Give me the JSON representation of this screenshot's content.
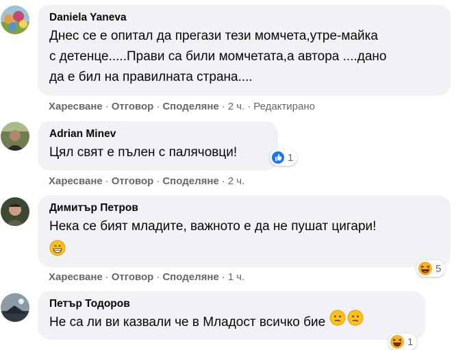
{
  "comments": [
    {
      "author": "Daniela Yaneva",
      "lines": [
        "Днес се е опитал да прегази тези момчета,утре-майка",
        "с детенце.....Прави са били момчетата,а автора ....дано",
        "да е бил на правилната страна...."
      ],
      "like": "Харесване",
      "reply": "Отговор",
      "share": "Споделяне",
      "time": "2 ч.",
      "edited": "Редактирано"
    },
    {
      "author": "Adrian Minev",
      "lines": [
        "Цял свят е пълен с палячовци!"
      ],
      "like": "Харесване",
      "reply": "Отговор",
      "share": "Споделяне",
      "time": "2 ч.",
      "reaction": {
        "icon": "like-icon",
        "count": "1",
        "color": "#1877f2"
      }
    },
    {
      "author": "Димитър Петров",
      "lines": [
        "Нека се бият младите, важното е да не пушат цигари!"
      ],
      "like": "Харесване",
      "reply": "Отговор",
      "share": "Споделяне",
      "time": "1 ч.",
      "reaction": {
        "icon": "haha-icon",
        "count": "5"
      }
    },
    {
      "author": "Петър Тодоров",
      "lines": [
        "Не са ли ви казвали че в Младост всичко бие"
      ],
      "reaction": {
        "icon": "haha-icon",
        "count": "1"
      }
    }
  ],
  "separator": "·",
  "colors": {
    "bubble": "#f0f2f5",
    "meta": "#65676b",
    "like_blue": "#1877f2"
  }
}
